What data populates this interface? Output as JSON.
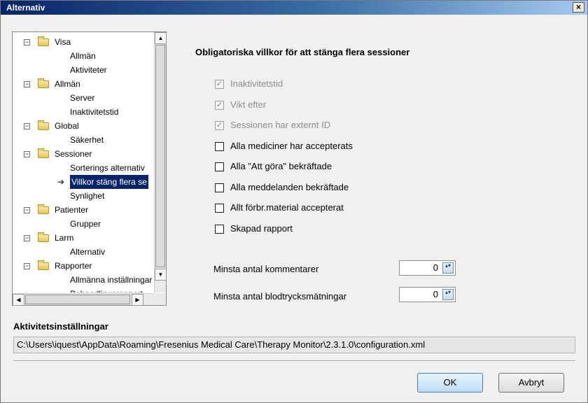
{
  "window": {
    "title": "Alternativ",
    "close_glyph": "×"
  },
  "tree": {
    "items": [
      {
        "label": "Visa",
        "level": 0,
        "expander": "−"
      },
      {
        "label": "Allmän",
        "level": 1
      },
      {
        "label": "Aktiviteter",
        "level": 1
      },
      {
        "label": "Allmän",
        "level": 0,
        "expander": "−"
      },
      {
        "label": "Server",
        "level": 1
      },
      {
        "label": "Inaktivitetstid",
        "level": 1
      },
      {
        "label": "Global",
        "level": 0,
        "expander": "−"
      },
      {
        "label": "Säkerhet",
        "level": 1
      },
      {
        "label": "Sessioner",
        "level": 0,
        "expander": "−"
      },
      {
        "label": "Sorterings alternativ",
        "level": 1
      },
      {
        "label": "Villkor stäng flera se",
        "level": 1,
        "selected": true
      },
      {
        "label": "Synlighet",
        "level": 1
      },
      {
        "label": "Patienter",
        "level": 0,
        "expander": "−"
      },
      {
        "label": "Grupper",
        "level": 1
      },
      {
        "label": "Larm",
        "level": 0,
        "expander": "−"
      },
      {
        "label": "Alternativ",
        "level": 1
      },
      {
        "label": "Rapporter",
        "level": 0,
        "expander": "−"
      },
      {
        "label": "Allmänna inställningar",
        "level": 1
      },
      {
        "label": "Behandlingsrapport",
        "level": 1
      }
    ],
    "selected_marker": "➔",
    "scroll_up": "▲",
    "scroll_down": "▼",
    "scroll_left": "◀",
    "scroll_right": "▶"
  },
  "main": {
    "section_title": "Obligatoriska villkor för att stänga flera sessioner",
    "checkboxes": [
      {
        "label": "Inaktivitetstid",
        "checked": true,
        "disabled": true
      },
      {
        "label": "Vikt efter",
        "checked": true,
        "disabled": true
      },
      {
        "label": "Sessionen har externt ID",
        "checked": true,
        "disabled": true
      },
      {
        "label": "Alla mediciner har accepterats",
        "checked": false,
        "disabled": false
      },
      {
        "label": "Alla \"Att göra\" bekräftade",
        "checked": false,
        "disabled": false
      },
      {
        "label": "Alla meddelanden bekräftade",
        "checked": false,
        "disabled": false
      },
      {
        "label": "Allt förbr.material accepterat",
        "checked": false,
        "disabled": false
      },
      {
        "label": "Skapad rapport",
        "checked": false,
        "disabled": false
      }
    ],
    "check_glyph": "✓",
    "numeric_fields": [
      {
        "label": "Minsta antal kommentarer",
        "value": "0"
      },
      {
        "label": "Minsta antal blodtrycksmätningar",
        "value": "0"
      }
    ],
    "spin_glyph": "▴▾"
  },
  "activity": {
    "title": "Aktivitetsinställningar",
    "path": "C:\\Users\\iquest\\AppData\\Roaming\\Fresenius Medical Care\\Therapy Monitor\\2.3.1.0\\configuration.xml"
  },
  "footer": {
    "ok_label": "OK",
    "cancel_label": "Avbryt"
  }
}
